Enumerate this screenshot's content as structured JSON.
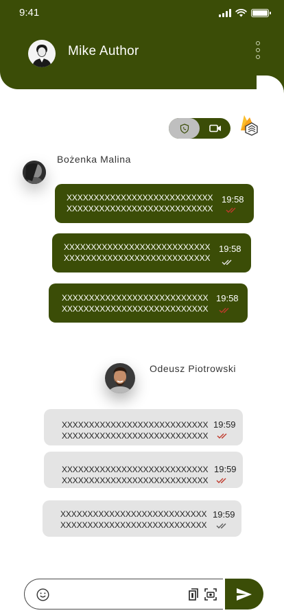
{
  "status_bar": {
    "time": "9:41"
  },
  "header": {
    "user_name": "Mike Author",
    "avatar_icon": "user-avatar-icon"
  },
  "call_toggle": {
    "voice_icon": "phone-shield-icon",
    "video_icon": "video-camera-icon"
  },
  "colors": {
    "brand": "#3b4d07",
    "incoming_bubble": "#e4e4e4",
    "read_tick": "#c0392b",
    "unread_tick": "#5a5a5a"
  },
  "threads": [
    {
      "sender": "Bożenka Malina",
      "messages": [
        {
          "line1": "XXXXXXXXXXXXXXXXXXXXXXXXXXX",
          "line2": "XXXXXXXXXXXXXXXXXXXXXXXXXXX",
          "time": "19:58",
          "status": "read"
        },
        {
          "line1": "XXXXXXXXXXXXXXXXXXXXXXXXXXX",
          "line2": "XXXXXXXXXXXXXXXXXXXXXXXXXXX",
          "time": "19:58",
          "status": "delivered"
        },
        {
          "line1": "XXXXXXXXXXXXXXXXXXXXXXXXXXX",
          "line2": "XXXXXXXXXXXXXXXXXXXXXXXXXXX",
          "time": "19:58",
          "status": "read"
        }
      ]
    },
    {
      "sender": "Odeusz Piotrowski",
      "messages": [
        {
          "line1": "XXXXXXXXXXXXXXXXXXXXXXXXXXX",
          "line2": "XXXXXXXXXXXXXXXXXXXXXXXXXXX",
          "time": "19:59",
          "status": "read"
        },
        {
          "line1": "XXXXXXXXXXXXXXXXXXXXXXXXXXX",
          "line2": "XXXXXXXXXXXXXXXXXXXXXXXXXXX",
          "time": "19:59",
          "status": "read"
        },
        {
          "line1": "XXXXXXXXXXXXXXXXXXXXXXXXXXX",
          "line2": "XXXXXXXXXXXXXXXXXXXXXXXXXXX",
          "time": "19:59",
          "status": "delivered"
        }
      ]
    }
  ],
  "composer": {
    "placeholder": "",
    "value": ""
  }
}
